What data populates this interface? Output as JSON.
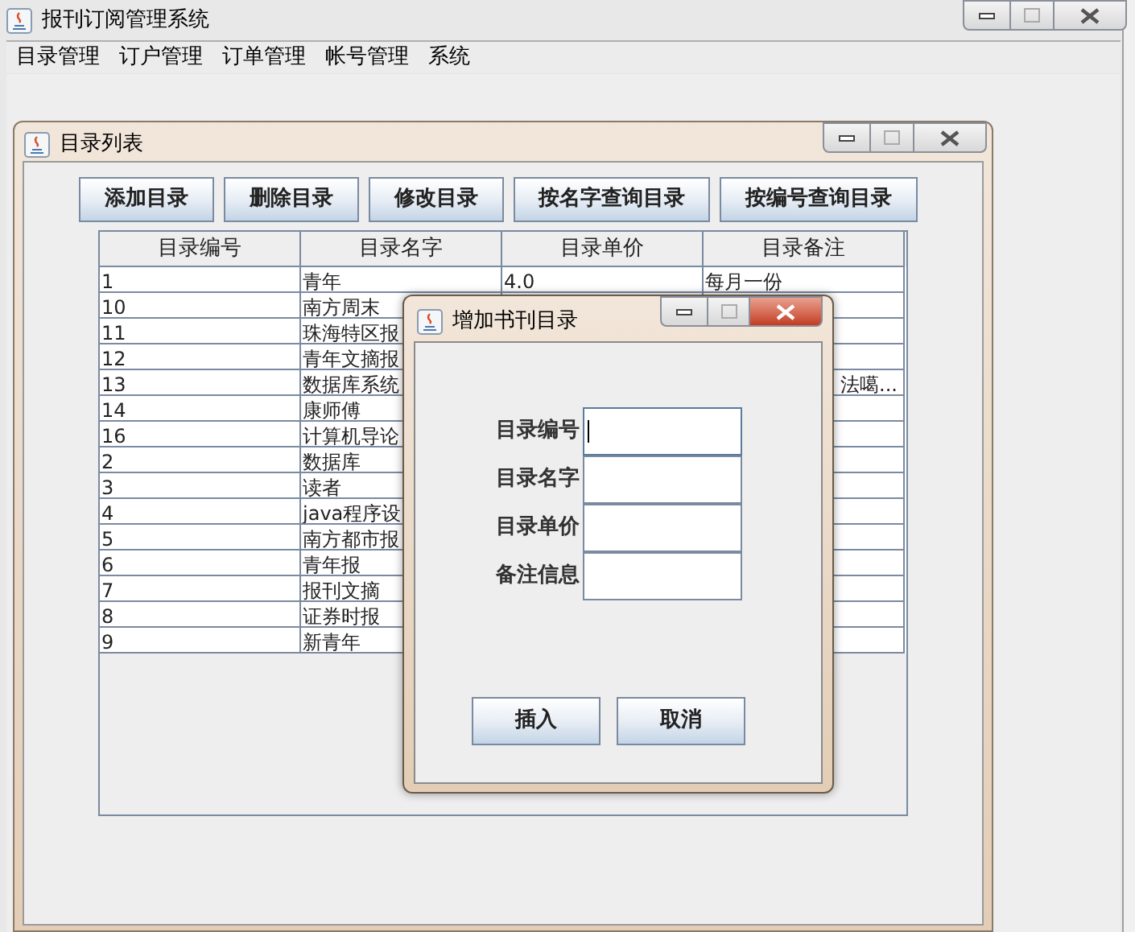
{
  "window": {
    "title": "报刊订阅管理系统"
  },
  "menu": [
    "目录管理",
    "订户管理",
    "订单管理",
    "帐号管理",
    "系统"
  ],
  "catalog_window": {
    "title": "目录列表",
    "buttons": [
      "添加目录",
      "删除目录",
      "修改目录",
      "按名字查询目录",
      "按编号查询目录"
    ],
    "table": {
      "columns": [
        "目录编号",
        "目录名字",
        "目录单价",
        "目录备注"
      ],
      "rows": [
        {
          "cells": [
            "1",
            "青年",
            "4.0",
            "每月一份"
          ]
        },
        {
          "cells": [
            "10",
            "南方周末"
          ]
        },
        {
          "cells": [
            "11",
            "珠海特区报"
          ]
        },
        {
          "cells": [
            "12",
            "青年文摘报"
          ]
        },
        {
          "cells": [
            "13",
            "数据库系统"
          ],
          "note": "法噶..."
        },
        {
          "cells": [
            "14",
            "康师傅"
          ]
        },
        {
          "cells": [
            "16",
            "计算机导论"
          ]
        },
        {
          "cells": [
            "2",
            "数据库"
          ]
        },
        {
          "cells": [
            "3",
            "读者"
          ]
        },
        {
          "cells": [
            "4",
            "java程序设"
          ]
        },
        {
          "cells": [
            "5",
            "南方都市报"
          ]
        },
        {
          "cells": [
            "6",
            "青年报"
          ]
        },
        {
          "cells": [
            "7",
            "报刊文摘"
          ]
        },
        {
          "cells": [
            "8",
            "证券时报"
          ]
        },
        {
          "cells": [
            "9",
            "新青年"
          ]
        }
      ]
    }
  },
  "dialog": {
    "title": "增加书刊目录",
    "fields": [
      {
        "label": "目录编号",
        "focused": true
      },
      {
        "label": "目录名字",
        "focused": false
      },
      {
        "label": "目录单价",
        "focused": false
      },
      {
        "label": "备注信息",
        "focused": false
      }
    ],
    "buttons": [
      "插入",
      "取消"
    ]
  }
}
